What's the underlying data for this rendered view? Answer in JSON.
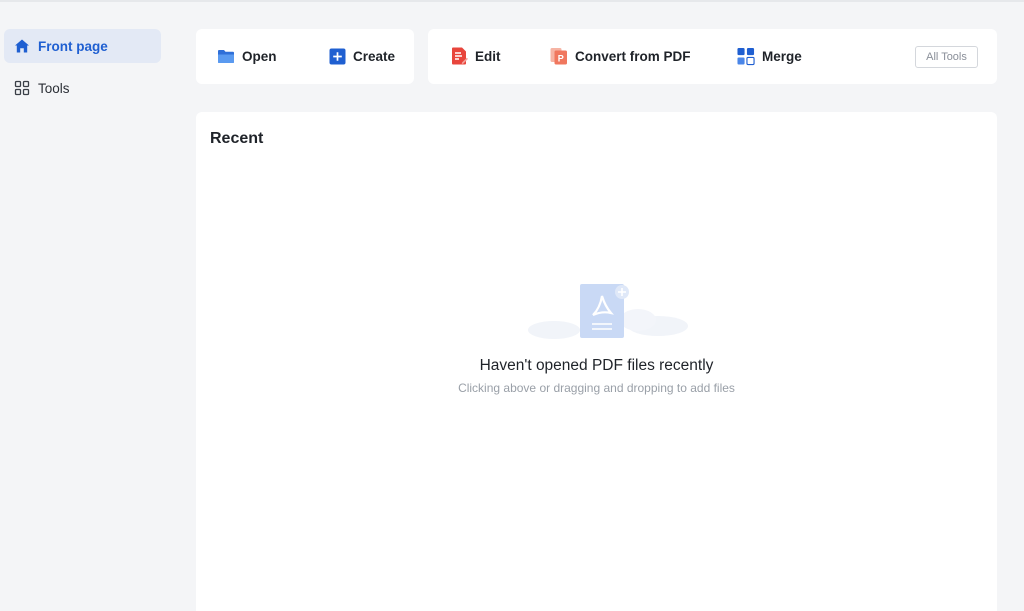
{
  "sidebar": {
    "items": [
      {
        "label": "Front page",
        "icon": "home-icon",
        "active": true
      },
      {
        "label": "Tools",
        "icon": "grid-icon",
        "active": false
      }
    ]
  },
  "toolbar": {
    "open_label": "Open",
    "create_label": "Create",
    "edit_label": "Edit",
    "convert_label": "Convert from PDF",
    "merge_label": "Merge",
    "all_tools_label": "All Tools"
  },
  "recent": {
    "title": "Recent",
    "empty_title": "Haven't opened PDF files recently",
    "empty_subtitle": "Clicking above or dragging and dropping to add files"
  },
  "colors": {
    "accent": "#1f5fd1",
    "edit_red": "#e8453c",
    "convert_orange": "#f0775e",
    "background": "#f4f5f7"
  }
}
